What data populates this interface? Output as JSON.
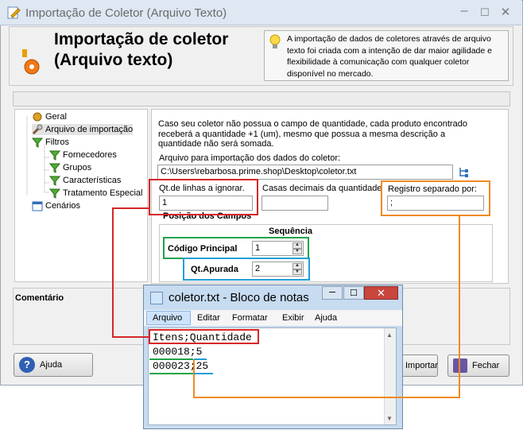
{
  "window": {
    "title": "Importação de Coletor (Arquivo Texto)"
  },
  "header": {
    "title_line1": "Importação de coletor",
    "title_line2": "(Arquivo texto)",
    "info": "A importação de dados de coletores através de arquivo texto foi criada com a intenção de dar maior agilidade e flexibilidade à comunicação com qualquer coletor disponível no mercado."
  },
  "tree": {
    "items": [
      {
        "label": "Geral",
        "icon": "gear-icon"
      },
      {
        "label": "Arquivo de importação",
        "icon": "wrench-icon"
      },
      {
        "label": "Filtros",
        "icon": "funnel-icon"
      },
      {
        "label": "Fornecedores",
        "icon": "funnel-icon"
      },
      {
        "label": "Grupos",
        "icon": "funnel-icon"
      },
      {
        "label": "Características",
        "icon": "funnel-icon"
      },
      {
        "label": "Tratamento Especial",
        "icon": "funnel-icon"
      },
      {
        "label": "Cenários",
        "icon": "calendar-icon"
      }
    ]
  },
  "form": {
    "note": "Caso seu coletor não possua o campo de quantidade, cada produto encontrado receberá a quantidade +1 (um), mesmo que possua a mesma descrição a quantidade não será somada.",
    "file_label": "Arquivo para importação dos dados do coletor:",
    "file_value": "C:\\Users\\rebarbosa.prime.shop\\Desktop\\coletor.txt",
    "lines_label": "Qt.de linhas a ignorar.",
    "lines_value": "1",
    "decimals_label": "Casas decimais da quantidade",
    "decimals_value": "",
    "separator_label": "Registro separado por:",
    "separator_value": ";",
    "fields_group_label": "Posição dos Campos",
    "sequence_label": "Sequência",
    "codigo_label": "Código Principal",
    "codigo_value": "1",
    "qt_label": "Qt.Apurada",
    "qt_value": "2"
  },
  "comment": {
    "label": "Comentário"
  },
  "buttons": {
    "help": "Ajuda",
    "import": "Importar",
    "close": "Fechar"
  },
  "notepad": {
    "title": "coletor.txt - Bloco de notas",
    "menu": [
      "Arquivo",
      "Editar",
      "Formatar",
      "Exibir",
      "Ajuda"
    ],
    "lines": [
      "Itens;Quantidade",
      "000018;5",
      "000023;25"
    ]
  },
  "colors": {
    "red": "#d62728",
    "green": "#1fa34a",
    "blue": "#1f9fd8",
    "orange": "#f08a24"
  }
}
